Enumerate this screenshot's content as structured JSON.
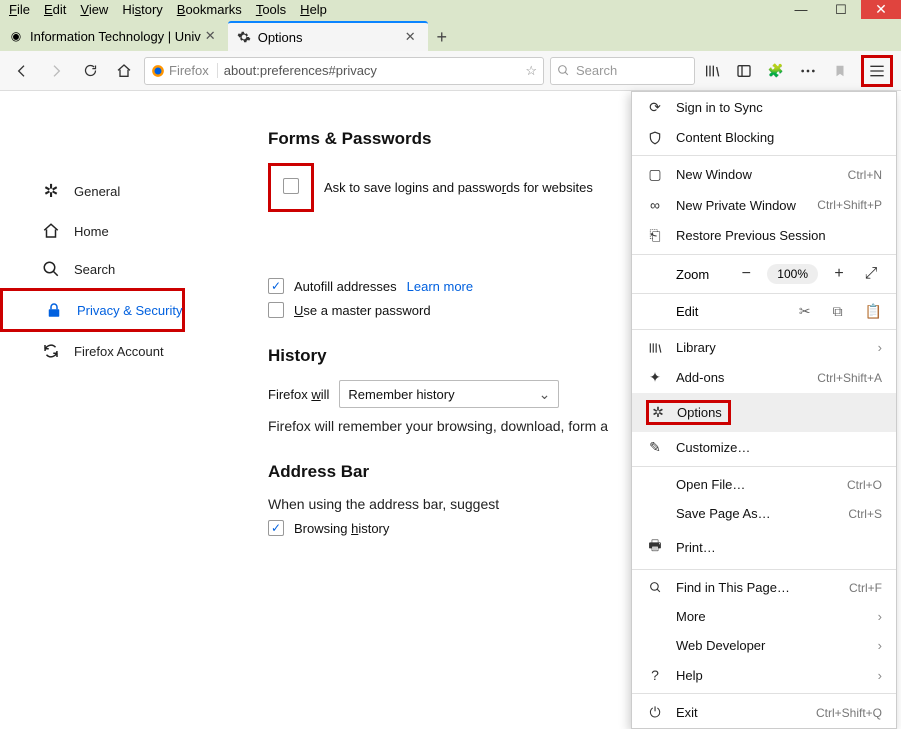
{
  "menubar": [
    "File",
    "Edit",
    "View",
    "History",
    "Bookmarks",
    "Tools",
    "Help"
  ],
  "tabs": [
    {
      "title": "Information Technology | Univ",
      "active": false
    },
    {
      "title": "Options",
      "active": true
    }
  ],
  "urlbar": {
    "identity": "Firefox",
    "address": "about:preferences#privacy"
  },
  "searchbar": {
    "placeholder": "Search"
  },
  "sidebar": {
    "items": [
      {
        "label": "General"
      },
      {
        "label": "Home"
      },
      {
        "label": "Search"
      },
      {
        "label": "Privacy & Security",
        "active": true
      },
      {
        "label": "Firefox Account"
      }
    ]
  },
  "main": {
    "forms_h": "Forms & Passwords",
    "ask_save": "Ask to save logins and passwords for websites",
    "autofill": "Autofill addresses",
    "learn_more": "Learn more",
    "master": "Use a master password",
    "history_h": "History",
    "ff_will": "Firefox will",
    "remember": "Remember history",
    "history_desc": "Firefox will remember your browsing, download, form a",
    "addr_h": "Address Bar",
    "addr_desc": "When using the address bar, suggest",
    "browsing": "Browsing history"
  },
  "panel": {
    "sync": "Sign in to Sync",
    "cblock": "Content Blocking",
    "nw": {
      "label": "New Window",
      "sc": "Ctrl+N"
    },
    "npw": {
      "label": "New Private Window",
      "sc": "Ctrl+Shift+P"
    },
    "restore": "Restore Previous Session",
    "zoom": {
      "label": "Zoom",
      "value": "100%"
    },
    "edit": "Edit",
    "library": "Library",
    "addons": {
      "label": "Add-ons",
      "sc": "Ctrl+Shift+A"
    },
    "options": "Options",
    "customize": "Customize…",
    "open": {
      "label": "Open File…",
      "sc": "Ctrl+O"
    },
    "save": {
      "label": "Save Page As…",
      "sc": "Ctrl+S"
    },
    "print": "Print…",
    "find": {
      "label": "Find in This Page…",
      "sc": "Ctrl+F"
    },
    "more": "More",
    "webdev": "Web Developer",
    "help": "Help",
    "exit": {
      "label": "Exit",
      "sc": "Ctrl+Shift+Q"
    }
  }
}
